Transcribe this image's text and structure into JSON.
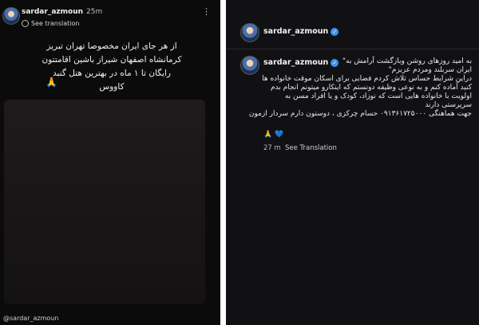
{
  "left_post": {
    "username": "sardar_azmoun",
    "time": "25m",
    "see_translation": "See translation",
    "caption": "از هر جای ایران مخصوصا تهران تبریز کرمانشاه اصفهان شیراز باشین اقامتتون رایگان تا ۱ ماه در بهترین هتل گنبد کاووس",
    "emoji": "🙏",
    "footer": "@sardar_azmoun"
  },
  "right_post": {
    "header_username": "sardar_azmoun",
    "caption_username": "sardar_azmoun",
    "caption": "به امید روزهای روشن وبازگشت آرامش به\"\nایران سربلند ومردم عزیزم\"\nدراین شرایط حساس تلاش کردم فضایی برای اسکان موقت خانواده ها\nکنید آماده کنم و به نوعی وظیفه دونستم که اینکارو میتونم انجام بدم\nاولویت با خانواده هایی است که نوزاد، کودک و یا افراد مسن به\nسرپرستی دارند\nجهت هماهنگی ۰۹۱۳۶۱۷۲۵۰۰۰ حسام چرکزی ، دوستون دارم سردار ازمون",
    "hearts": "🙏 💙",
    "time": "27 m",
    "see_translation": "See Translation"
  },
  "colors": {
    "panel_bg": "#0b0b0b",
    "verified": "#3897f0"
  },
  "icons": [
    "more-options-icon",
    "globe-icon",
    "verified-badge-icon"
  ]
}
